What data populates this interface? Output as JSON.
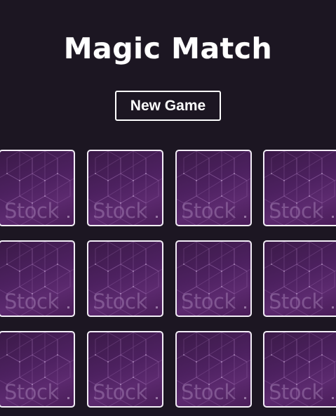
{
  "title": "Magic Match",
  "new_game_label": "New Game",
  "card_back": {
    "watermark": "Stock",
    "colors": {
      "dark": "#3b1a48",
      "mid": "#4d2160",
      "light": "#5c2a6f",
      "border": "#f3eef7"
    }
  },
  "grid": {
    "rows": 3,
    "columns": 4
  },
  "cards": [
    {
      "state": "face-down"
    },
    {
      "state": "face-down"
    },
    {
      "state": "face-down"
    },
    {
      "state": "face-down"
    },
    {
      "state": "face-down"
    },
    {
      "state": "face-down"
    },
    {
      "state": "face-down"
    },
    {
      "state": "face-down"
    },
    {
      "state": "face-down"
    },
    {
      "state": "face-down"
    },
    {
      "state": "face-down"
    },
    {
      "state": "face-down"
    }
  ],
  "colors": {
    "background": "#1c1622",
    "text": "#ffffff"
  }
}
